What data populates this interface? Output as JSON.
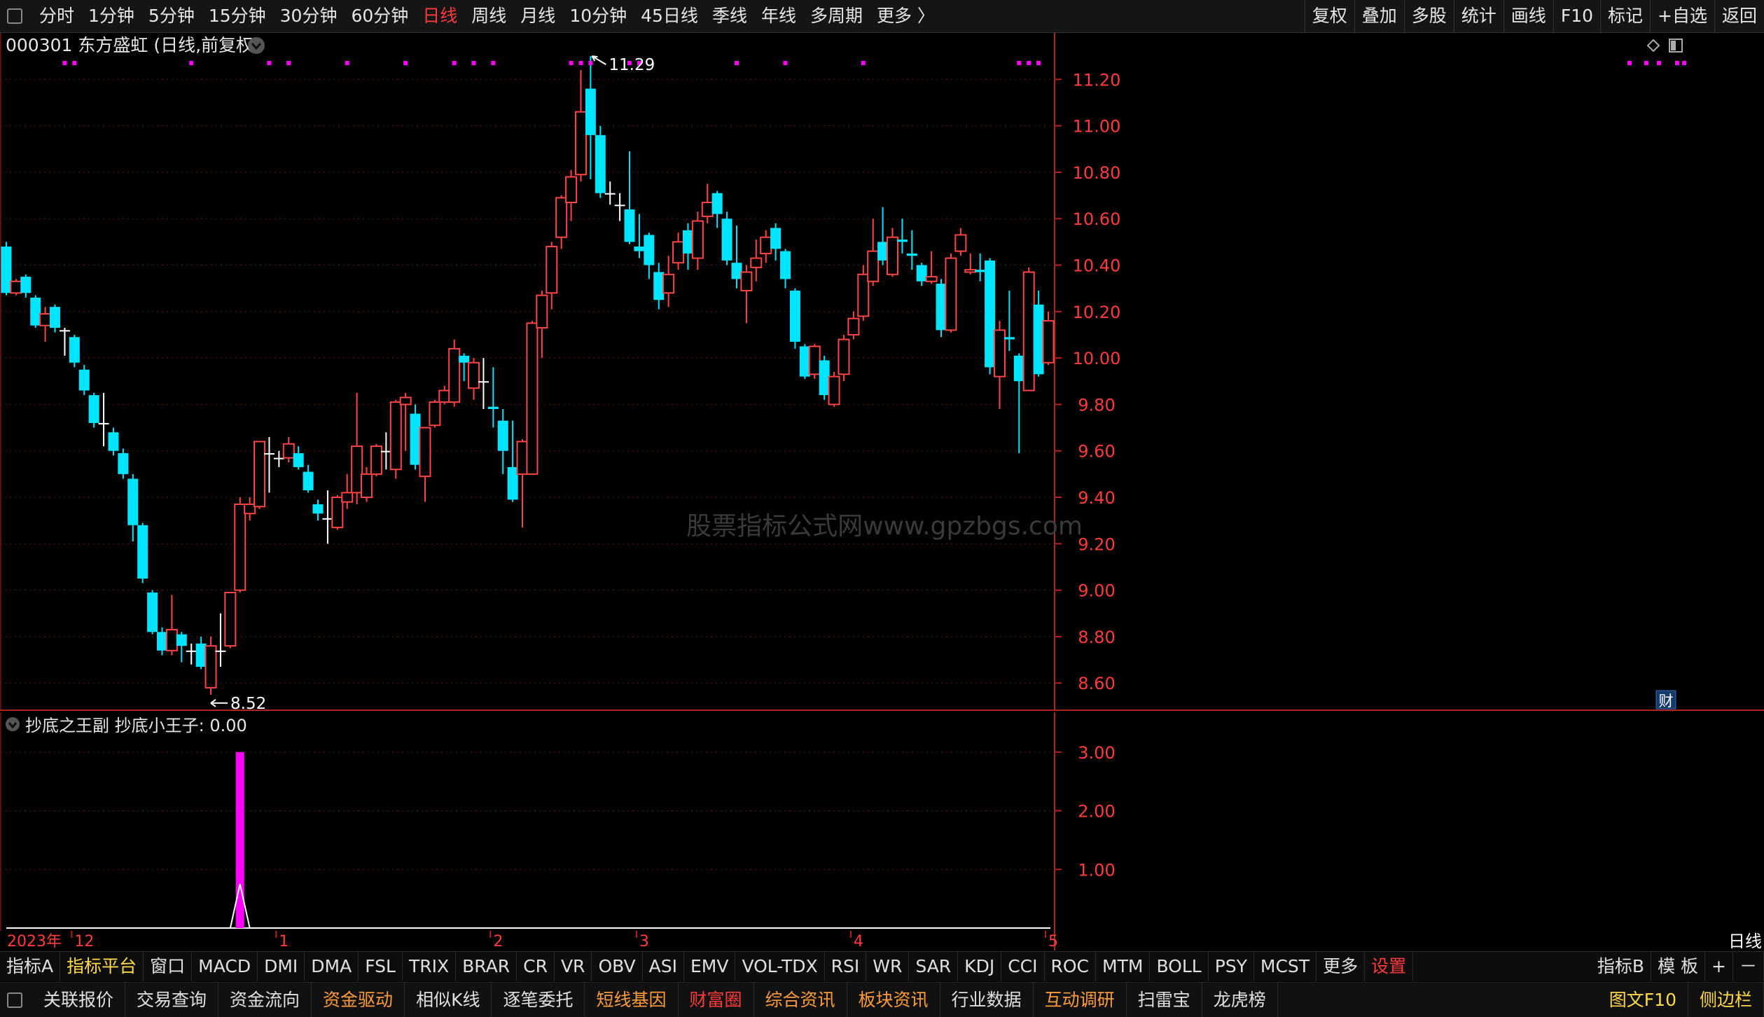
{
  "top_nav": {
    "periods": [
      "分时",
      "1分钟",
      "5分钟",
      "15分钟",
      "30分钟",
      "60分钟",
      "日线",
      "周线",
      "月线",
      "10分钟",
      "45日线",
      "季线",
      "年线",
      "多周期",
      "更多 〉"
    ],
    "active_period": "日线",
    "right_buttons": [
      "复权",
      "叠加",
      "多股",
      "统计",
      "画线",
      "F10",
      "标记",
      "+自选",
      "返回"
    ]
  },
  "stock": {
    "code": "000301",
    "name": "东方盛虹",
    "mode": "(日线,前复权)"
  },
  "main_chart": {
    "high_label": "11.29",
    "low_label": "8.52",
    "cai_badge": "财",
    "watermark": "股票指标公式网www.gpzbgs.com"
  },
  "sub_chart": {
    "indicator_name": "抄底之王副",
    "series_label": "抄底小王子: 0.00"
  },
  "chart_data": [
    {
      "type": "candlestick",
      "title": "000301 东方盛虹 (日线,前复权)",
      "y_ticks": [
        "11.20",
        "11.00",
        "10.80",
        "10.60",
        "10.40",
        "10.20",
        "10.00",
        "9.80",
        "9.60",
        "9.40",
        "9.20",
        "9.00",
        "8.80",
        "8.60"
      ],
      "ylim": [
        8.48,
        11.4
      ],
      "up_color": "#ff4444",
      "down_color": "#00e5ff",
      "candles": [
        [
          10.48,
          10.28,
          10.5,
          10.27
        ],
        [
          10.28,
          10.33,
          10.34,
          10.27
        ],
        [
          10.35,
          10.28,
          10.36,
          10.26
        ],
        [
          10.26,
          10.14,
          10.27,
          10.13
        ],
        [
          10.14,
          10.19,
          10.22,
          10.07
        ],
        [
          10.22,
          10.13,
          10.23,
          10.11
        ],
        [
          10.12,
          10.12,
          10.13,
          10.01
        ],
        [
          10.09,
          9.98,
          10.1,
          9.96
        ],
        [
          9.95,
          9.86,
          9.97,
          9.84
        ],
        [
          9.84,
          9.72,
          9.85,
          9.7
        ],
        [
          9.72,
          9.72,
          9.85,
          9.62
        ],
        [
          9.68,
          9.6,
          9.7,
          9.58
        ],
        [
          9.59,
          9.5,
          9.61,
          9.48
        ],
        [
          9.48,
          9.28,
          9.5,
          9.21
        ],
        [
          9.28,
          9.05,
          9.29,
          9.03
        ],
        [
          8.99,
          8.82,
          9.0,
          8.81
        ],
        [
          8.82,
          8.74,
          8.84,
          8.72
        ],
        [
          8.74,
          8.83,
          8.98,
          8.72
        ],
        [
          8.81,
          8.76,
          8.82,
          8.69
        ],
        [
          8.74,
          8.74,
          8.77,
          8.68
        ],
        [
          8.77,
          8.67,
          8.8,
          8.66
        ],
        [
          8.58,
          8.76,
          8.8,
          8.55
        ],
        [
          8.74,
          8.74,
          8.9,
          8.67
        ],
        [
          8.76,
          8.99,
          8.99,
          8.75
        ],
        [
          9.0,
          9.37,
          9.4,
          8.99
        ],
        [
          9.33,
          9.37,
          9.4,
          9.3
        ],
        [
          9.36,
          9.64,
          9.64,
          9.35
        ],
        [
          9.59,
          9.59,
          9.66,
          9.42
        ],
        [
          9.57,
          9.57,
          9.6,
          9.53
        ],
        [
          9.57,
          9.63,
          9.66,
          9.55
        ],
        [
          9.59,
          9.53,
          9.62,
          9.52
        ],
        [
          9.51,
          9.43,
          9.54,
          9.42
        ],
        [
          9.37,
          9.33,
          9.39,
          9.3
        ],
        [
          9.31,
          9.31,
          9.43,
          9.2
        ],
        [
          9.27,
          9.4,
          9.41,
          9.26
        ],
        [
          9.38,
          9.42,
          9.5,
          9.35
        ],
        [
          9.42,
          9.62,
          9.85,
          9.37
        ],
        [
          9.4,
          9.5,
          9.53,
          9.38
        ],
        [
          9.5,
          9.62,
          9.63,
          9.49
        ],
        [
          9.6,
          9.6,
          9.68,
          9.52
        ],
        [
          9.52,
          9.81,
          9.82,
          9.48
        ],
        [
          9.8,
          9.83,
          9.85,
          9.6
        ],
        [
          9.76,
          9.54,
          9.8,
          9.52
        ],
        [
          9.49,
          9.7,
          9.7,
          9.38
        ],
        [
          9.71,
          9.81,
          9.82,
          9.7
        ],
        [
          9.81,
          9.86,
          9.88,
          9.8
        ],
        [
          9.81,
          10.04,
          10.08,
          9.79
        ],
        [
          10.01,
          9.98,
          10.02,
          9.9
        ],
        [
          9.87,
          9.98,
          10.0,
          9.82
        ],
        [
          9.9,
          9.9,
          10.0,
          9.78
        ],
        [
          9.79,
          9.78,
          9.96,
          9.7
        ],
        [
          9.73,
          9.6,
          9.78,
          9.5
        ],
        [
          9.53,
          9.39,
          9.73,
          9.38
        ],
        [
          9.5,
          9.64,
          9.65,
          9.27
        ],
        [
          9.5,
          10.15,
          10.16,
          9.5
        ],
        [
          10.13,
          10.27,
          10.29,
          10.0
        ],
        [
          10.28,
          10.48,
          10.5,
          10.21
        ],
        [
          10.52,
          10.69,
          10.7,
          10.47
        ],
        [
          10.67,
          10.78,
          10.81,
          10.59
        ],
        [
          10.79,
          11.06,
          11.24,
          10.76
        ],
        [
          11.16,
          10.96,
          11.3,
          10.77
        ],
        [
          10.96,
          10.71,
          11.0,
          10.69
        ],
        [
          10.71,
          10.71,
          10.76,
          10.66
        ],
        [
          10.66,
          10.66,
          10.71,
          10.59
        ],
        [
          10.64,
          10.5,
          10.89,
          10.49
        ],
        [
          10.48,
          10.46,
          10.62,
          10.43
        ],
        [
          10.53,
          10.4,
          10.54,
          10.34
        ],
        [
          10.37,
          10.25,
          10.41,
          10.21
        ],
        [
          10.28,
          10.36,
          10.44,
          10.22
        ],
        [
          10.41,
          10.5,
          10.54,
          10.38
        ],
        [
          10.55,
          10.45,
          10.58,
          10.38
        ],
        [
          10.43,
          10.59,
          10.63,
          10.38
        ],
        [
          10.61,
          10.67,
          10.75,
          10.58
        ],
        [
          10.71,
          10.62,
          10.72,
          10.56
        ],
        [
          10.6,
          10.42,
          10.63,
          10.4
        ],
        [
          10.41,
          10.34,
          10.57,
          10.3
        ],
        [
          10.29,
          10.37,
          10.4,
          10.15
        ],
        [
          10.39,
          10.43,
          10.51,
          10.33
        ],
        [
          10.45,
          10.52,
          10.55,
          10.41
        ],
        [
          10.56,
          10.47,
          10.58,
          10.42
        ],
        [
          10.46,
          10.34,
          10.47,
          10.3
        ],
        [
          10.29,
          10.07,
          10.3,
          10.04
        ],
        [
          10.05,
          9.92,
          10.06,
          9.91
        ],
        [
          9.93,
          10.05,
          10.06,
          9.91
        ],
        [
          9.99,
          9.84,
          10.01,
          9.82
        ],
        [
          9.8,
          9.92,
          9.94,
          9.79
        ],
        [
          9.93,
          10.08,
          10.1,
          9.9
        ],
        [
          10.1,
          10.17,
          10.2,
          10.08
        ],
        [
          10.18,
          10.36,
          10.4,
          10.16
        ],
        [
          10.33,
          10.46,
          10.6,
          10.31
        ],
        [
          10.5,
          10.42,
          10.65,
          10.4
        ],
        [
          10.36,
          10.52,
          10.56,
          10.35
        ],
        [
          10.51,
          10.5,
          10.6,
          10.45
        ],
        [
          10.45,
          10.44,
          10.55,
          10.38
        ],
        [
          10.4,
          10.33,
          10.41,
          10.31
        ],
        [
          10.33,
          10.35,
          10.46,
          10.32
        ],
        [
          10.32,
          10.12,
          10.34,
          10.09
        ],
        [
          10.12,
          10.43,
          10.45,
          10.11
        ],
        [
          10.46,
          10.53,
          10.56,
          10.44
        ],
        [
          10.37,
          10.38,
          10.45,
          10.36
        ],
        [
          10.38,
          10.37,
          10.45,
          10.33
        ],
        [
          10.42,
          9.96,
          10.43,
          9.93
        ],
        [
          9.92,
          10.12,
          10.16,
          9.78
        ],
        [
          10.09,
          10.08,
          10.29,
          10.03
        ],
        [
          10.01,
          9.9,
          10.02,
          9.59
        ],
        [
          9.86,
          10.37,
          10.39,
          9.86
        ],
        [
          10.23,
          9.93,
          10.29,
          9.92
        ],
        [
          9.98,
          10.16,
          10.2,
          9.97
        ]
      ],
      "signal_days": [
        6,
        7,
        19,
        27,
        29,
        35,
        41,
        46,
        48,
        50,
        58,
        59,
        60,
        64,
        65,
        75,
        80,
        88,
        104,
        105,
        106
      ]
    },
    {
      "type": "bar",
      "title": "抄底之王副",
      "series": [
        {
          "name": "抄底小王子",
          "values": [
            {
              "index": 24,
              "value": 3.0
            }
          ]
        },
        {
          "name": "line",
          "values": [
            {
              "index": 24,
              "value": 0.75
            }
          ]
        }
      ],
      "y_ticks": [
        "3.00",
        "2.00",
        "1.00"
      ],
      "ylim": [
        0,
        3.2
      ],
      "bar_color": "#ff00ff"
    }
  ],
  "date_axis": {
    "labels": [
      {
        "text": "2023年",
        "index": 0
      },
      {
        "text": "12",
        "index": 7
      },
      {
        "text": "1",
        "index": 28
      },
      {
        "text": "2",
        "index": 50
      },
      {
        "text": "3",
        "index": 65
      },
      {
        "text": "4",
        "index": 87
      },
      {
        "text": "5",
        "index": 107
      }
    ],
    "period_label": "日线"
  },
  "indicator_tabs": {
    "items": [
      "指标A",
      "指标平台",
      "窗口",
      "MACD",
      "DMI",
      "DMA",
      "FSL",
      "TRIX",
      "BRAR",
      "CR",
      "VR",
      "OBV",
      "ASI",
      "EMV",
      "VOL-TDX",
      "RSI",
      "WR",
      "SAR",
      "KDJ",
      "CCI",
      "ROC",
      "MTM",
      "BOLL",
      "PSY",
      "MCST",
      "更多",
      "设置"
    ],
    "right": [
      "指标B",
      "模 板",
      "+",
      "－"
    ]
  },
  "bottom_toolbar": {
    "items": [
      "关联报价",
      "交易查询",
      "资金流向",
      "资金驱动",
      "相似K线",
      "逐笔委托",
      "短线基因",
      "财富圈",
      "综合资讯",
      "板块资讯",
      "行业数据",
      "互动调研",
      "扫雷宝",
      "龙虎榜"
    ],
    "right": [
      "图文F10",
      "侧边栏"
    ]
  }
}
